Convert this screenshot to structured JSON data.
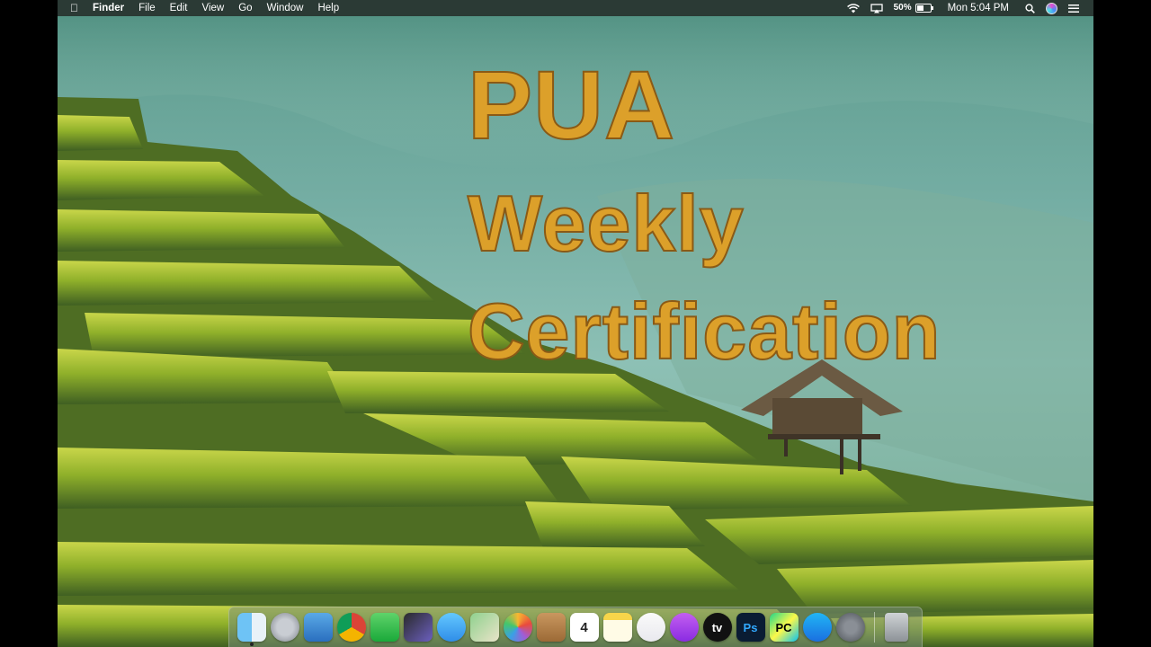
{
  "menubar": {
    "apple_icon": "apple-logo-icon",
    "app_name": "Finder",
    "menus": [
      "File",
      "Edit",
      "View",
      "Go",
      "Window",
      "Help"
    ],
    "battery_percent": "50%",
    "battery_level": 0.5,
    "clock": "Mon 5:04 PM",
    "status_icons": [
      "wifi-icon",
      "airplay-icon",
      "battery-icon",
      "spotlight-icon",
      "siri-icon",
      "notification-center-icon"
    ]
  },
  "desktop": {
    "title_lines": [
      "PUA",
      "Weekly",
      "Certification"
    ],
    "title_color": "#dca02a",
    "title_outline_color": "#8a5a16"
  },
  "dock": {
    "apps": [
      {
        "name": "Finder",
        "icon": "finder-icon",
        "running": true
      },
      {
        "name": "Launchpad",
        "icon": "launchpad-icon"
      },
      {
        "name": "Mail",
        "icon": "mail-icon"
      },
      {
        "name": "Google Chrome",
        "icon": "chrome-icon"
      },
      {
        "name": "FaceTime",
        "icon": "facetime-icon"
      },
      {
        "name": "Final Cut Pro",
        "icon": "final-cut-pro-icon"
      },
      {
        "name": "Messages",
        "icon": "messages-icon"
      },
      {
        "name": "Maps",
        "icon": "maps-icon"
      },
      {
        "name": "Photos",
        "icon": "photos-icon"
      },
      {
        "name": "Contacts",
        "icon": "contacts-icon"
      },
      {
        "name": "Calendar",
        "icon": "calendar-icon",
        "text": "4"
      },
      {
        "name": "Notes",
        "icon": "notes-icon"
      },
      {
        "name": "Music",
        "icon": "music-icon"
      },
      {
        "name": "Podcasts",
        "icon": "podcasts-icon"
      },
      {
        "name": "TV",
        "icon": "apple-tv-icon",
        "text": "tv"
      },
      {
        "name": "Photoshop",
        "icon": "photoshop-icon",
        "text": "Ps"
      },
      {
        "name": "PyCharm",
        "icon": "pycharm-icon",
        "text": "PC"
      },
      {
        "name": "App Store",
        "icon": "app-store-icon"
      },
      {
        "name": "System Preferences",
        "icon": "system-preferences-icon"
      }
    ],
    "trash": {
      "name": "Trash",
      "icon": "trash-icon"
    }
  }
}
